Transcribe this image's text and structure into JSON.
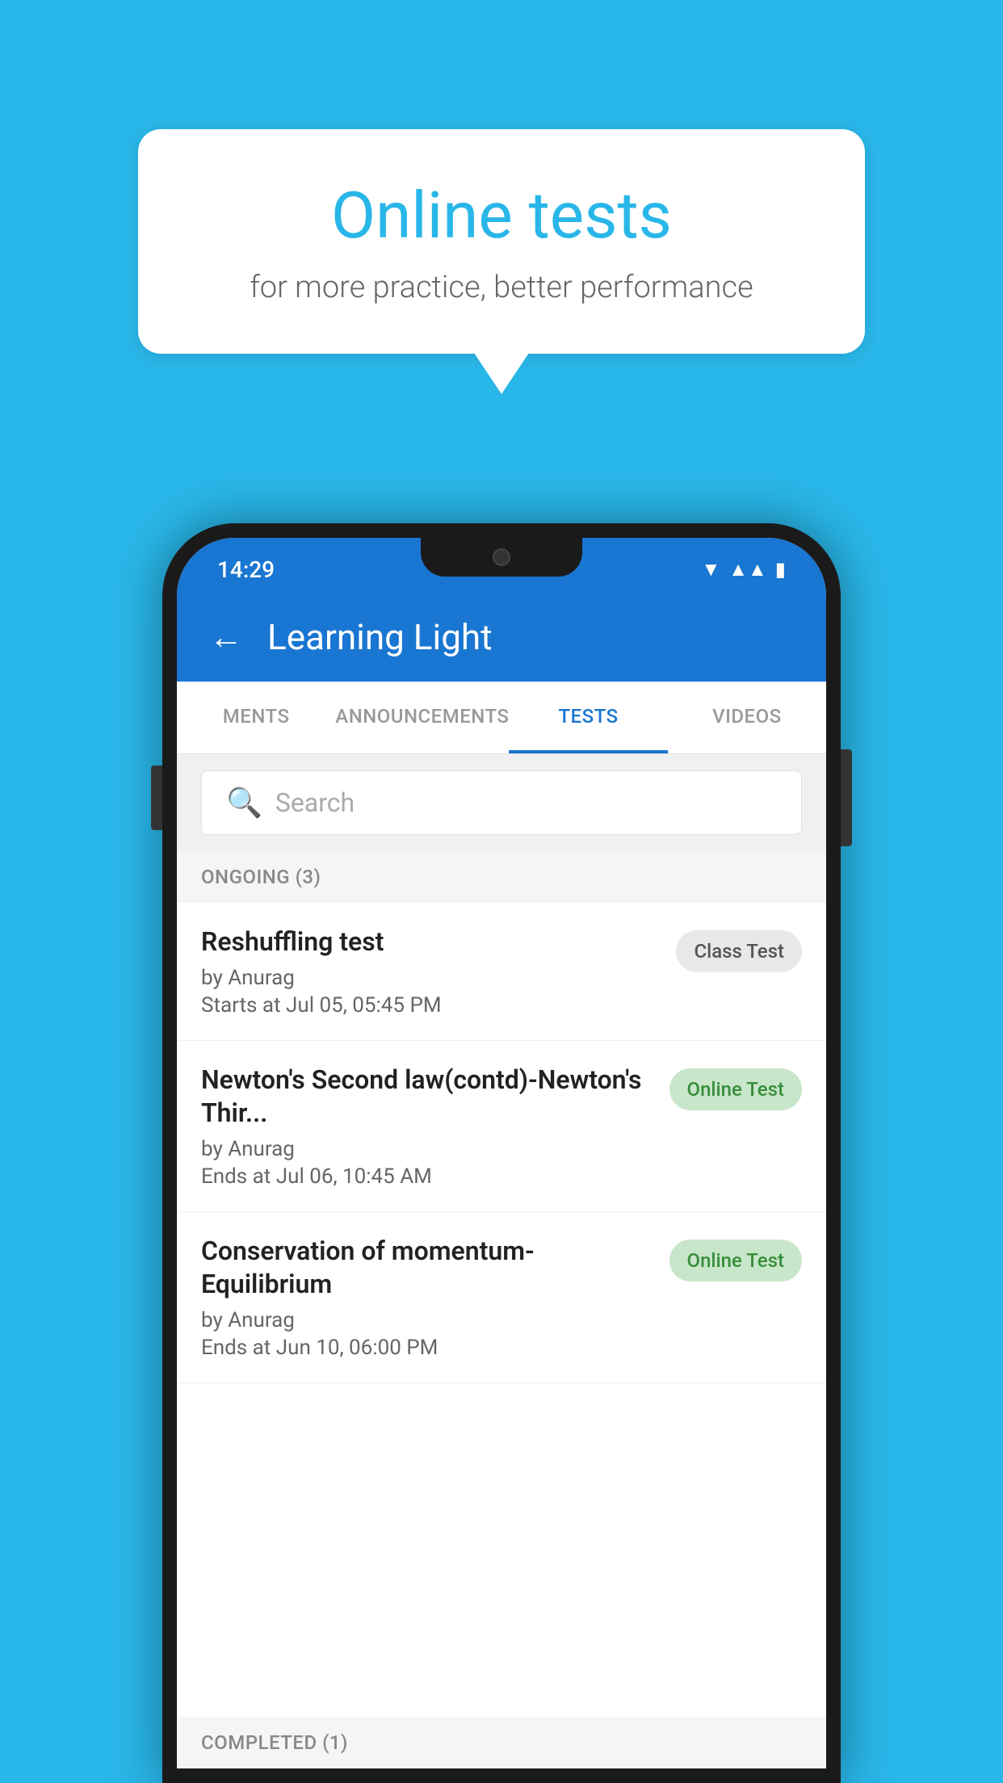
{
  "background": {
    "color": "#29B6E8"
  },
  "speech_bubble": {
    "title": "Online tests",
    "subtitle": "for more practice, better performance"
  },
  "status_bar": {
    "time": "14:29",
    "wifi": "▼",
    "signal": "▲",
    "battery": "▮"
  },
  "app_header": {
    "back_label": "←",
    "title": "Learning Light"
  },
  "tabs": [
    {
      "label": "MENTS",
      "active": false
    },
    {
      "label": "ANNOUNCEMENTS",
      "active": false
    },
    {
      "label": "TESTS",
      "active": true
    },
    {
      "label": "VIDEOS",
      "active": false
    }
  ],
  "search": {
    "placeholder": "Search",
    "icon": "🔍"
  },
  "ongoing_section": {
    "label": "ONGOING (3)",
    "tests": [
      {
        "name": "Reshuffling test",
        "author": "by Anurag",
        "time_label": "Starts at",
        "time": "Jul 05, 05:45 PM",
        "badge": "Class Test",
        "badge_type": "class"
      },
      {
        "name": "Newton's Second law(contd)-Newton's Thir...",
        "author": "by Anurag",
        "time_label": "Ends at",
        "time": "Jul 06, 10:45 AM",
        "badge": "Online Test",
        "badge_type": "online"
      },
      {
        "name": "Conservation of momentum-Equilibrium",
        "author": "by Anurag",
        "time_label": "Ends at",
        "time": "Jun 10, 06:00 PM",
        "badge": "Online Test",
        "badge_type": "online"
      }
    ]
  },
  "completed_section": {
    "label": "COMPLETED (1)"
  }
}
